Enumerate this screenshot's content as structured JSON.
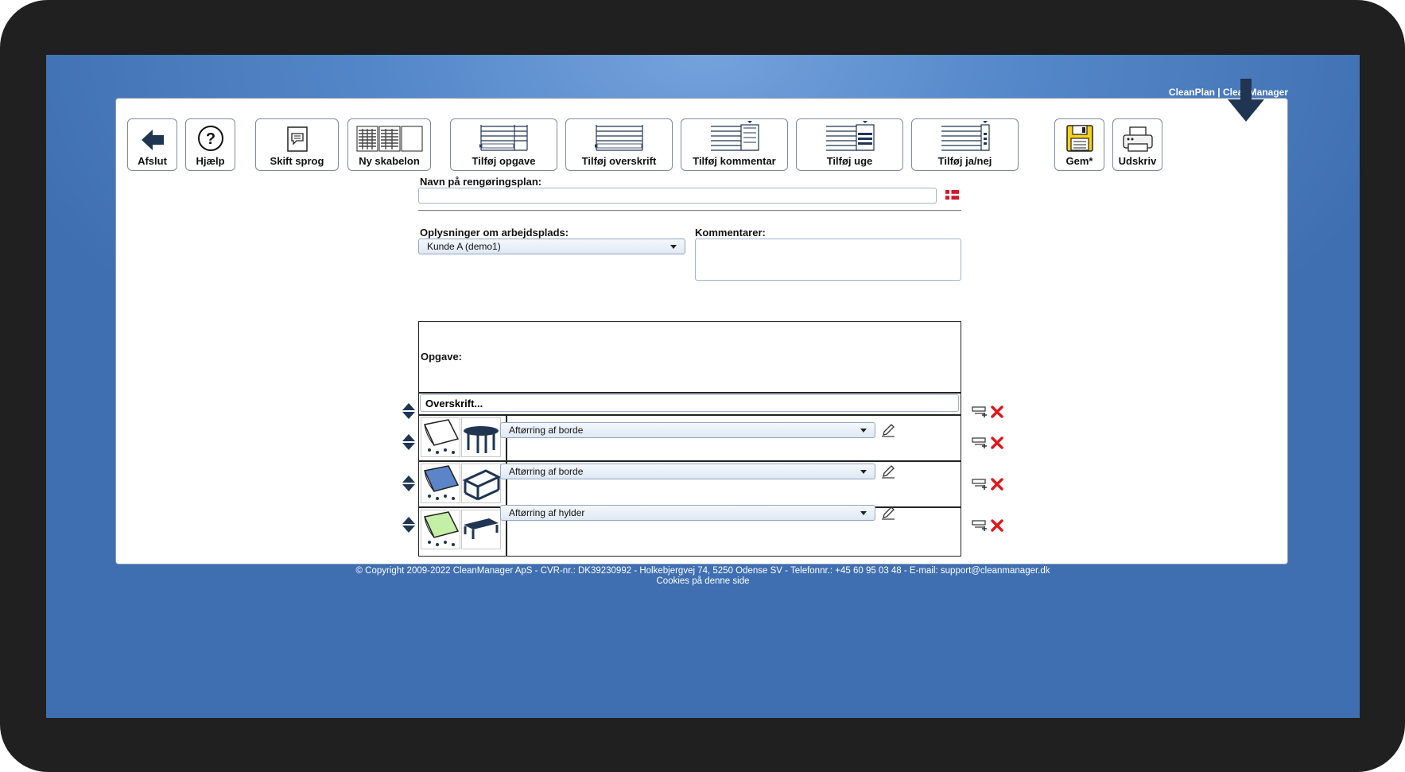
{
  "app": {
    "brand": "CleanPlan | CleanManager"
  },
  "toolbar": {
    "exit": "Afslut",
    "help": "Hjælp",
    "language": "Skift sprog",
    "new_template": "Ny skabelon",
    "add_task": "Tilføj opgave",
    "add_heading": "Tilføj overskrift",
    "add_comment": "Tilføj kommentar",
    "add_week": "Tilføj uge",
    "add_yesno": "Tilføj ja/nej",
    "save": "Gem*",
    "print": "Udskriv"
  },
  "form": {
    "plan_name_label": "Navn på rengøringsplan:",
    "plan_name_value": "",
    "workplace_label": "Oplysninger om arbejdsplads:",
    "workplace_value": "Kunde A (demo1)",
    "comments_label": "Kommentarer:",
    "comments_value": ""
  },
  "table": {
    "task_header": "Opgave:",
    "heading_row_value": "Overskrift...",
    "rows": [
      {
        "task": "Aftørring af borde",
        "cloth_color": "#ffffff",
        "object": "round-table"
      },
      {
        "task": "Aftørring af borde",
        "cloth_color": "#5b85c8",
        "object": "square-table"
      },
      {
        "task": "Aftørring af hylder",
        "cloth_color": "#c3f0a6",
        "object": "shelf"
      }
    ]
  },
  "footer": {
    "copyright": "© Copyright 2009-2022 CleanManager ApS - CVR-nr.: DK39230992 - Holkebjergvej 74, 5250 Odense SV - Telefonnr.: +45 60 95 03 48 - E-mail: support@cleanmanager.dk",
    "cookies": "Cookies på denne side"
  },
  "colors": {
    "accent_navy": "#1f3552",
    "delete_red": "#e0161a",
    "background_blue": "#5487c9"
  }
}
